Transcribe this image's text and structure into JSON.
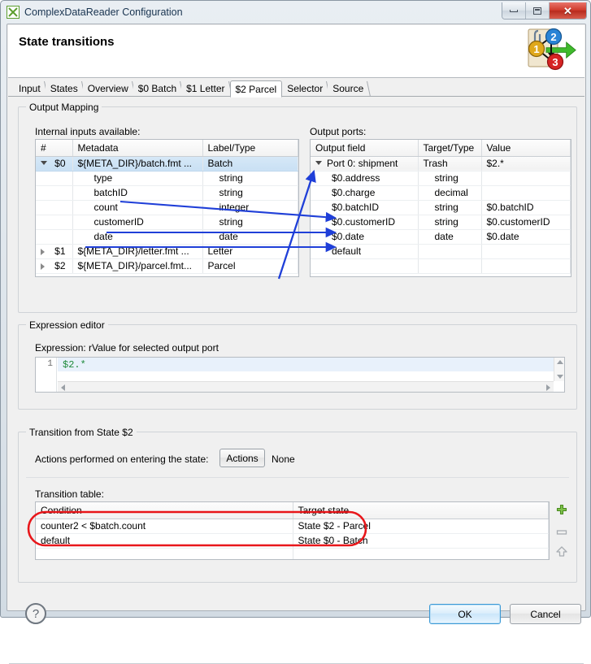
{
  "window": {
    "title": "ComplexDataReader Configuration",
    "app_icon": "grid-icon",
    "minimize": "minimize-icon",
    "maximize": "maximize-icon",
    "close": "✕"
  },
  "banner": {
    "title": "State transitions",
    "icon": "state-transition-diagram-icon",
    "badges": [
      "1",
      "2",
      "3"
    ]
  },
  "tabs": [
    {
      "label": "Input",
      "active": false
    },
    {
      "label": "States",
      "active": false
    },
    {
      "label": "Overview",
      "active": false
    },
    {
      "label": "$0 Batch",
      "active": false
    },
    {
      "label": "$1 Letter",
      "active": false
    },
    {
      "label": "$2 Parcel",
      "active": true
    },
    {
      "label": "Selector",
      "active": false
    },
    {
      "label": "Source",
      "active": false
    }
  ],
  "output_mapping": {
    "group_title": "Output Mapping",
    "inputs_label": "Internal inputs available:",
    "ports_label": "Output ports:",
    "inputs_table": {
      "headers": [
        "#",
        "Metadata",
        "Label/Type"
      ],
      "rows": [
        {
          "num": "$0",
          "metadata": "${META_DIR}/batch.fmt ...",
          "type": "Batch",
          "level": 0,
          "twisty": "open",
          "selected": true,
          "dim": false
        },
        {
          "num": "",
          "metadata": "type",
          "type": "string",
          "level": 1,
          "twisty": "",
          "selected": false,
          "dim": false
        },
        {
          "num": "",
          "metadata": "batchID",
          "type": "string",
          "level": 1,
          "twisty": "",
          "selected": false,
          "dim": false
        },
        {
          "num": "",
          "metadata": "count",
          "type": "integer",
          "level": 1,
          "twisty": "",
          "selected": false,
          "dim": false
        },
        {
          "num": "",
          "metadata": "customerID",
          "type": "string",
          "level": 1,
          "twisty": "",
          "selected": false,
          "dim": false
        },
        {
          "num": "",
          "metadata": "date",
          "type": "date",
          "level": 1,
          "twisty": "",
          "selected": false,
          "dim": false
        },
        {
          "num": "$1",
          "metadata": "${META_DIR}/letter.fmt ...",
          "type": "Letter",
          "level": 0,
          "twisty": "closed",
          "selected": false,
          "dim": true
        },
        {
          "num": "$2",
          "metadata": "${META_DIR}/parcel.fmt...",
          "type": "Parcel",
          "level": 0,
          "twisty": "closed",
          "selected": false,
          "dim": true
        }
      ]
    },
    "ports_table": {
      "headers": [
        "Output field",
        "Target/Type",
        "Value"
      ],
      "rows": [
        {
          "field": "Port 0: shipment",
          "target": "Trash",
          "value": "$2.*",
          "level": 0,
          "twisty": "open",
          "header_row": true,
          "dim": false
        },
        {
          "field": "$0.address",
          "target": "string",
          "value": "",
          "level": 1,
          "twisty": "",
          "header_row": false,
          "dim": false
        },
        {
          "field": "$0.charge",
          "target": "decimal",
          "value": "",
          "level": 1,
          "twisty": "",
          "header_row": false,
          "dim": false
        },
        {
          "field": "$0.batchID",
          "target": "string",
          "value": "$0.batchID",
          "level": 1,
          "twisty": "",
          "header_row": false,
          "dim": false
        },
        {
          "field": "$0.customerID",
          "target": "string",
          "value": "$0.customerID",
          "level": 1,
          "twisty": "",
          "header_row": false,
          "dim": false
        },
        {
          "field": "$0.date",
          "target": "date",
          "value": "$0.date",
          "level": 1,
          "twisty": "",
          "header_row": false,
          "dim": false
        },
        {
          "field": "default",
          "target": "",
          "value": "",
          "level": 1,
          "twisty": "",
          "header_row": false,
          "dim": true
        },
        {
          "field": "",
          "target": "",
          "value": "",
          "level": 1,
          "twisty": "",
          "header_row": false,
          "dim": false
        }
      ]
    }
  },
  "expression_editor": {
    "group_title": "Expression editor",
    "label": "Expression: rValue for selected output port",
    "line_number": "1",
    "code": "$2.*",
    "code_color": "#1f8a3b"
  },
  "transition": {
    "group_title": "Transition from State $2",
    "actions_label": "Actions performed on entering the state:",
    "actions_button": "Actions",
    "actions_value": "None",
    "table_label": "Transition table:",
    "table": {
      "headers": [
        "Condition",
        "Target state"
      ],
      "rows": [
        {
          "condition": "counter2 < $batch.count",
          "target": "State $2 - Parcel",
          "dim": false
        },
        {
          "condition": "default",
          "target": "State $0 - Batch",
          "dim": true
        },
        {
          "condition": "",
          "target": "",
          "dim": false
        }
      ]
    },
    "add_button": "add-row-icon",
    "remove_button": "remove-row-icon",
    "moveup_button": "move-up-icon"
  },
  "footer": {
    "help": "?",
    "ok": "OK",
    "cancel": "Cancel"
  },
  "annotations": {
    "arrow_color": "#1f3fd8",
    "highlight_color": "#e8161a"
  }
}
